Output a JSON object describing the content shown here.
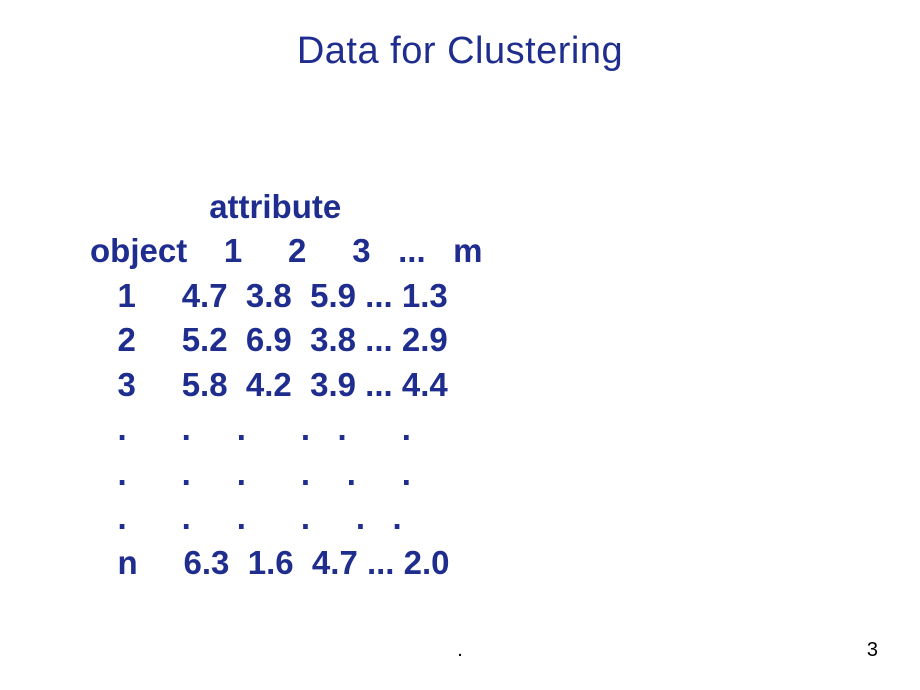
{
  "title": "Data for Clustering",
  "header_attribute": "             attribute",
  "header_columns": "object    1     2     3   ...   m",
  "rows": [
    "   1     4.7  3.8  5.9 ... 1.3",
    "   2     5.2  6.9  3.8 ... 2.9",
    "   3     5.8  4.2  3.9 ... 4.4",
    "   .      .     .      .   .      .",
    "   .      .     .      .    .     .",
    "   .      .     .      .     .   .",
    "   n     6.3  1.6  4.7 ... 2.0"
  ],
  "footer_dot": ".",
  "page_number": "3"
}
